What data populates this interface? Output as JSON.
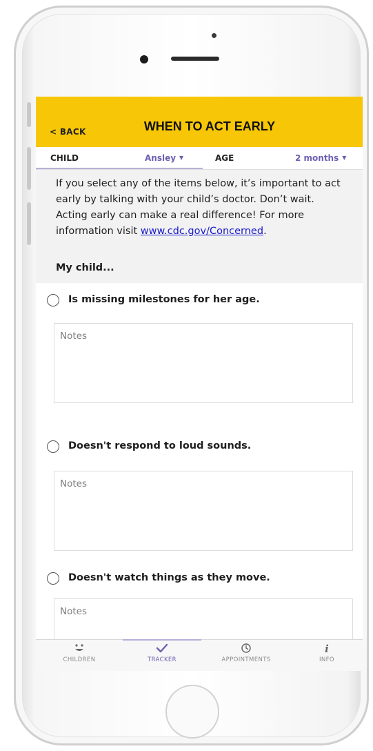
{
  "header": {
    "back_label": "< BACK",
    "title": "WHEN TO ACT EARLY"
  },
  "selector": {
    "child_label": "CHILD",
    "child_value": "Ansley",
    "age_label": "AGE",
    "age_value": "2 months"
  },
  "intro": {
    "text": "If you select any of the items below, it’s important to act early by talking with your child’s doctor. Don’t wait. Acting early can make a real difference! For more information visit ",
    "link_text": "www.cdc.gov/Concerned",
    "text_end": ".",
    "section_heading": "My child..."
  },
  "items": [
    {
      "label": "Is missing milestones for her age.",
      "notes_placeholder": "Notes"
    },
    {
      "label": "Doesn't respond to loud sounds.",
      "notes_placeholder": "Notes"
    },
    {
      "label": "Doesn't watch things as they move.",
      "notes_placeholder": "Notes"
    }
  ],
  "tabs": [
    {
      "label": "CHILDREN",
      "icon": "smiley-face-icon"
    },
    {
      "label": "TRACKER",
      "icon": "checkmark-icon"
    },
    {
      "label": "APPOINTMENTS",
      "icon": "clock-icon"
    },
    {
      "label": "INFO",
      "icon": "info-icon"
    }
  ],
  "colors": {
    "header_bg": "#f7c707",
    "accent": "#6d5fb2",
    "link": "#1a1acc",
    "intro_bg": "#f2f2f2"
  }
}
